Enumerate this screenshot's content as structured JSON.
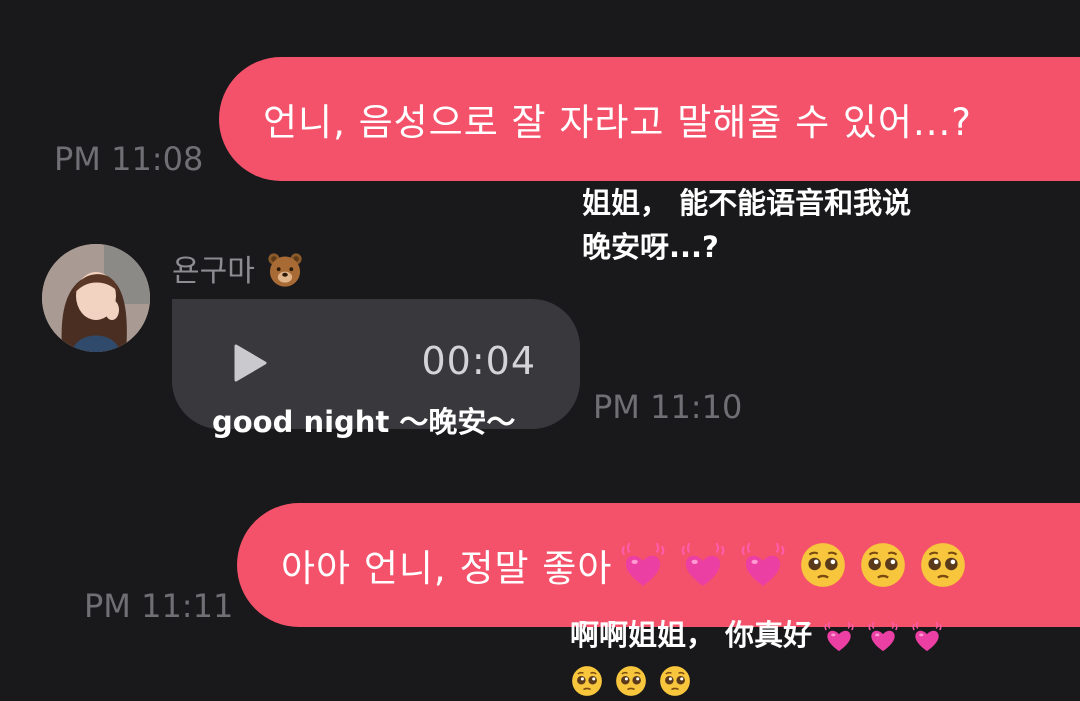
{
  "messages": {
    "out1": {
      "text": "언니, 음성으로 잘 자라고 말해줄 수 있어...?",
      "time": "PM 11:08",
      "translation_line1": "姐姐， 能不能语音和我说",
      "translation_line2": "晚安呀...?"
    },
    "in1": {
      "sender": "욘구마",
      "sender_emoji": "bear-face-emoji",
      "duration": "00:04",
      "time": "PM 11:10",
      "translation": "good night ～晚安～"
    },
    "out2": {
      "text": "아아 언니, 정말 좋아",
      "emojis": [
        "growing-heart-emoji",
        "growing-heart-emoji",
        "growing-heart-emoji",
        "pleading-face-emoji",
        "pleading-face-emoji",
        "pleading-face-emoji"
      ],
      "time": "PM 11:11",
      "translation_line1": "啊啊姐姐， 你真好",
      "translation_line2_emojis": [
        "pleading-face-emoji",
        "pleading-face-emoji",
        "pleading-face-emoji"
      ]
    }
  },
  "colors": {
    "background": "#19191b",
    "outgoing_bubble": "#f4526a",
    "incoming_bubble": "#38383d",
    "timestamp": "#6f6f74"
  }
}
